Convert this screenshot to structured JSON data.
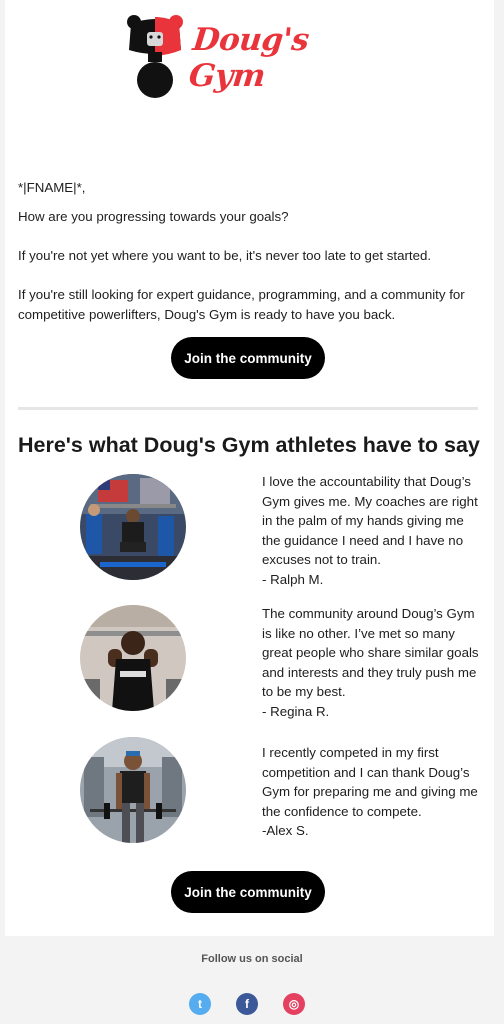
{
  "header": {
    "brand_name": "Doug's Gym",
    "accent_color": "#e8343a"
  },
  "body": {
    "greeting": "*|FNAME|*,",
    "paragraph_1": "How are you progressing towards your goals?",
    "paragraph_2": "If you're not yet where you want to be, it's never too late to get started.",
    "paragraph_3": "If you're still looking for expert guidance, programming, and a community for competitive powerlifters, Doug's Gym is ready to have you back.",
    "cta_label": "Join the community"
  },
  "testimonials": {
    "heading": "Here's what Doug's Gym athletes have to say",
    "items": [
      {
        "quote": "I love the accountability that Doug’s Gym gives me. My coaches are right in the palm of my hands giving me the guidance I need and I have no excuses not to train.",
        "author": "- Ralph M.",
        "image": "athlete-squat-photo"
      },
      {
        "quote": "The community around Doug’s Gym is like no other. I’ve met so many great people who share similar goals and interests and they truly push me to be my best.",
        "author": "- Regina R.",
        "image": "athlete-savage-photo"
      },
      {
        "quote": "I recently competed in my first competition and I can thank Doug’s Gym for preparing me and giving me the confidence to compete.",
        "author": "-Alex S.",
        "image": "athlete-deadlift-photo"
      }
    ],
    "cta_label": "Join the community"
  },
  "footer": {
    "follow_label": "Follow us on social",
    "social": [
      {
        "icon": "twitter-icon",
        "glyph": "t",
        "color": "#55acee"
      },
      {
        "icon": "facebook-icon",
        "glyph": "f",
        "color": "#3b5998"
      },
      {
        "icon": "instagram-icon",
        "glyph": "◎",
        "color": "#e4405f"
      }
    ]
  }
}
